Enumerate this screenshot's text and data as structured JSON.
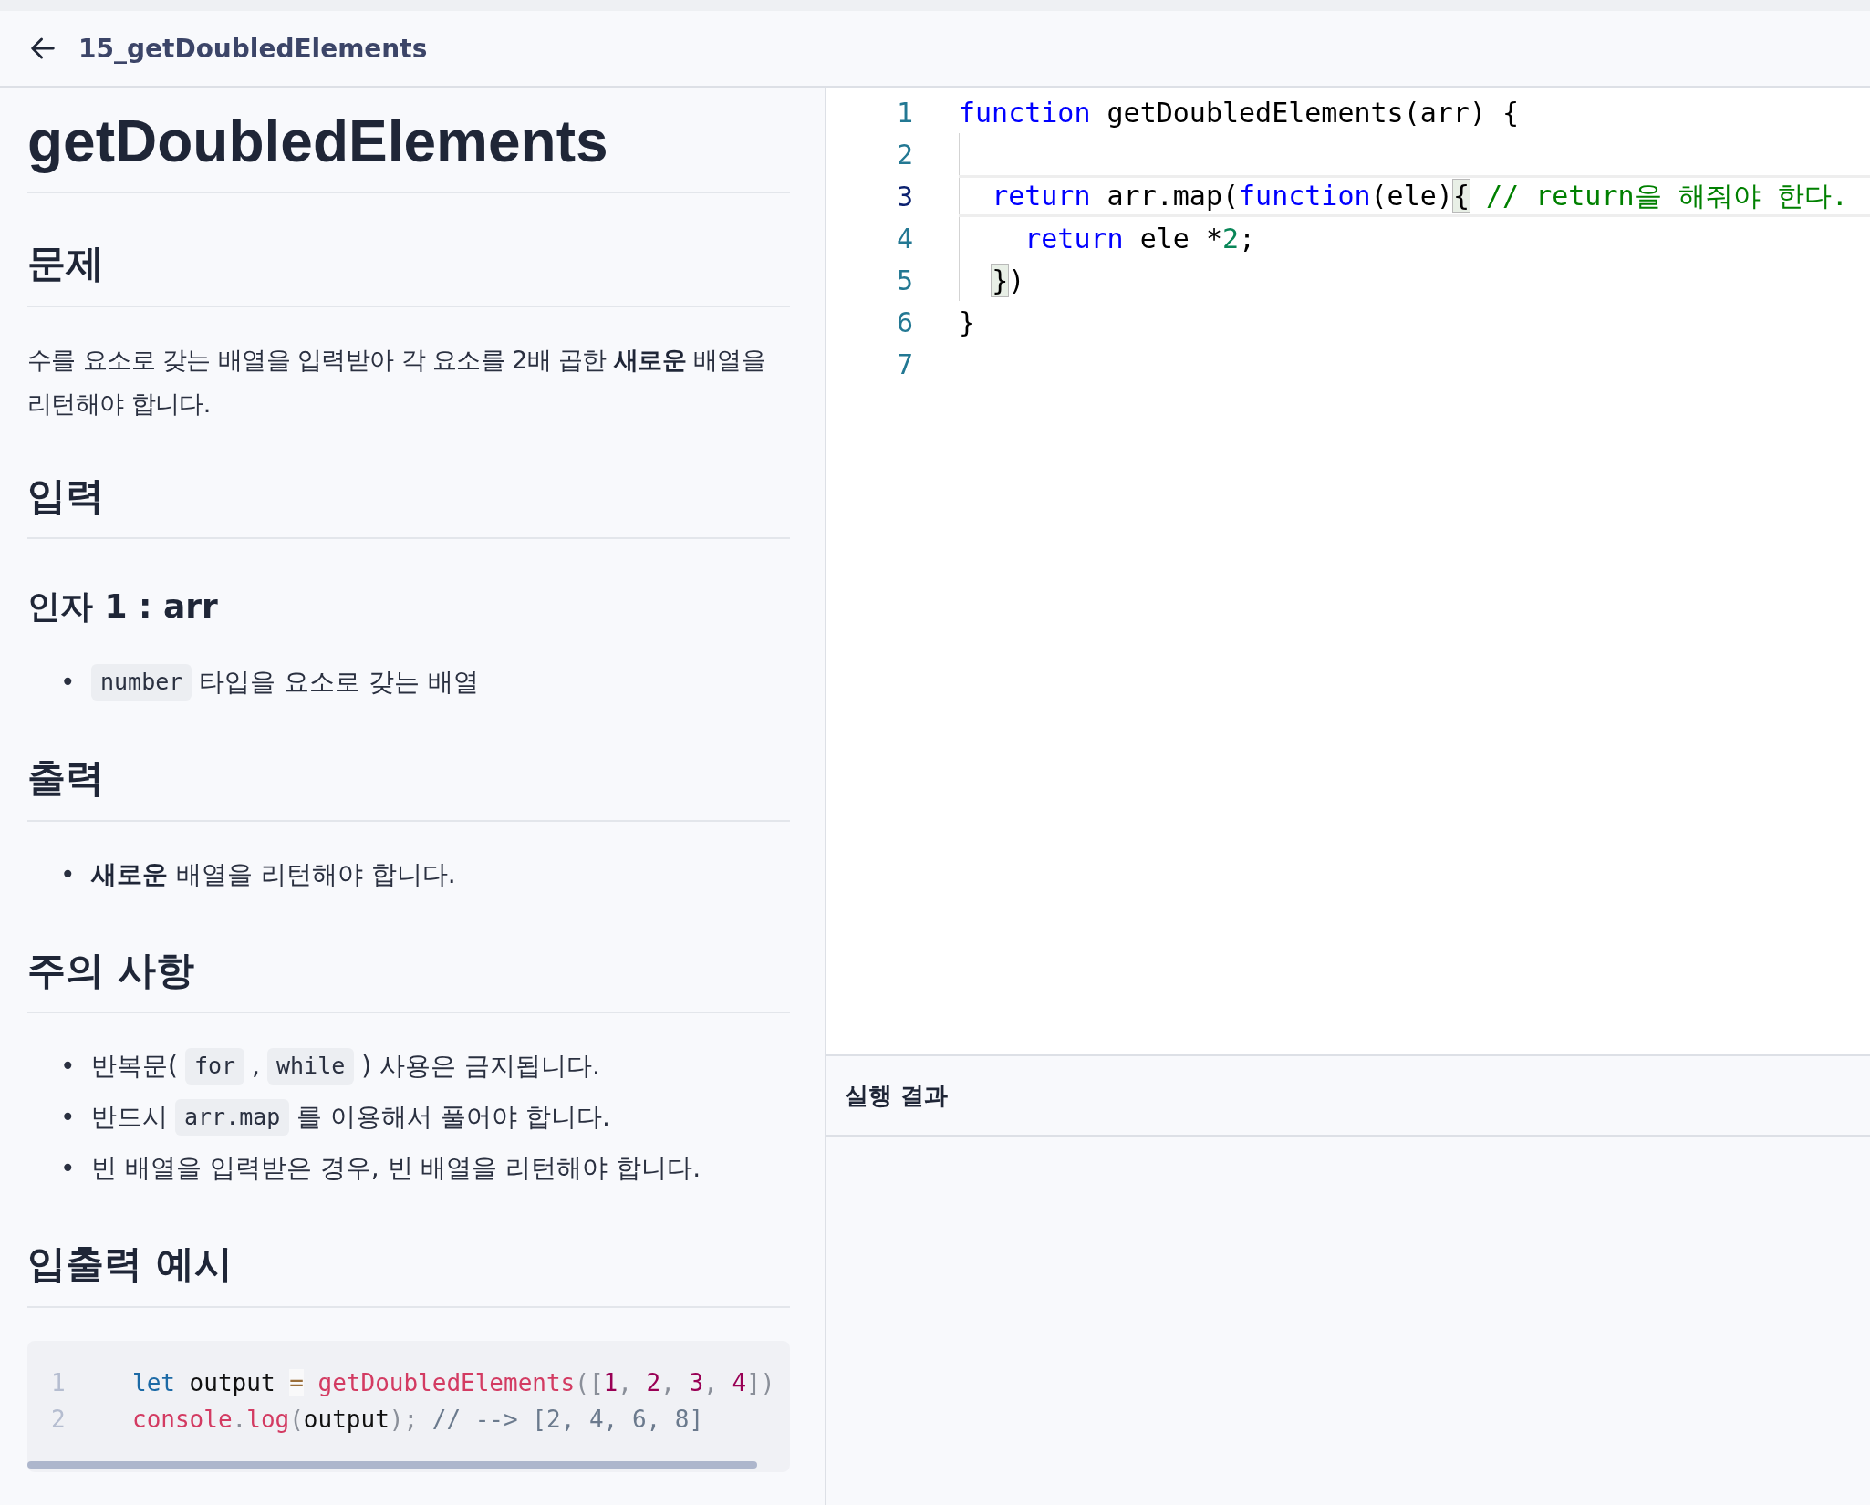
{
  "header": {
    "title": "15_getDoubledElements"
  },
  "problem": {
    "title": "getDoubledElements",
    "sections": [
      {
        "heading": "문제",
        "blocks": [
          {
            "kind": "paragraph",
            "text": "수를 요소로 갖는 배열을 입력받아 각 요소를 2배 곱한 **새로운** 배열을 리턴해야 합니다."
          }
        ]
      },
      {
        "heading": "입력",
        "blocks": [
          {
            "kind": "subheading",
            "text": "인자 1 : arr"
          },
          {
            "kind": "list",
            "bullet": "•",
            "items": [
              [
                {
                  "kind": "code",
                  "text": "number"
                },
                {
                  "kind": "text",
                  "text": "타입을 요소로 갖는 배열"
                }
              ]
            ]
          }
        ]
      },
      {
        "heading": "출력",
        "blocks": [
          {
            "kind": "list",
            "bullet": "•",
            "items": [
              [
                {
                  "kind": "text",
                  "text": "**새로운** 배열을 리턴해야 합니다."
                }
              ]
            ]
          }
        ]
      },
      {
        "heading": "주의 사항",
        "blocks": [
          {
            "kind": "list",
            "bullet": "•",
            "items": [
              [
                {
                  "kind": "text",
                  "text": "반복문("
                },
                {
                  "kind": "code",
                  "text": "for"
                },
                {
                  "kind": "text",
                  "text": ","
                },
                {
                  "kind": "code",
                  "text": "while"
                },
                {
                  "kind": "text",
                  "text": ") 사용은 금지됩니다."
                }
              ],
              [
                {
                  "kind": "text",
                  "text": "반드시"
                },
                {
                  "kind": "code",
                  "text": "arr.map"
                },
                {
                  "kind": "text",
                  "text": "를 이용해서 풀어야 합니다."
                }
              ],
              [
                {
                  "kind": "text",
                  "text": "빈 배열을 입력받은 경우, 빈 배열을 리턴해야 합니다."
                }
              ]
            ]
          }
        ]
      },
      {
        "heading": "입출력 예시",
        "blocks": [
          {
            "kind": "code_block",
            "lines": [
              {
                "number": "1",
                "tokens": [
                  {
                    "kind": "kw",
                    "text": "let"
                  },
                  {
                    "kind": "plain",
                    "text": " output "
                  },
                  {
                    "kind": "op",
                    "text": "="
                  },
                  {
                    "kind": "fn",
                    "text": " getDoubledElements"
                  },
                  {
                    "kind": "punc",
                    "text": "(["
                  },
                  {
                    "kind": "num",
                    "text": "1"
                  },
                  {
                    "kind": "punc",
                    "text": ", "
                  },
                  {
                    "kind": "num",
                    "text": "2"
                  },
                  {
                    "kind": "punc",
                    "text": ", "
                  },
                  {
                    "kind": "num",
                    "text": "3"
                  },
                  {
                    "kind": "punc",
                    "text": ", "
                  },
                  {
                    "kind": "num",
                    "text": "4"
                  },
                  {
                    "kind": "punc",
                    "text": "])"
                  }
                ]
              },
              {
                "number": "2",
                "tokens": [
                  {
                    "kind": "fn",
                    "text": "console"
                  },
                  {
                    "kind": "punc",
                    "text": "."
                  },
                  {
                    "kind": "fn",
                    "text": "log"
                  },
                  {
                    "kind": "punc",
                    "text": "("
                  },
                  {
                    "kind": "plain",
                    "text": "output"
                  },
                  {
                    "kind": "punc",
                    "text": "); "
                  },
                  {
                    "kind": "comment",
                    "text": "// --> [2, 4, 6, 8]"
                  }
                ]
              }
            ]
          }
        ]
      }
    ]
  },
  "editor": {
    "lines": [
      {
        "number": "1",
        "current": false,
        "tokens": [
          {
            "kind": "kw",
            "text": "function"
          },
          {
            "kind": "plain",
            "text": " getDoubledElements(arr) {"
          }
        ]
      },
      {
        "number": "2",
        "current": false
      },
      {
        "number": "3",
        "current": true,
        "tokens": [
          {
            "kind": "kw",
            "text": "  return"
          },
          {
            "kind": "plain",
            "text": " arr.map("
          },
          {
            "kind": "kw",
            "text": "function"
          },
          {
            "kind": "plain",
            "text": "(ele)"
          },
          {
            "kind": "match",
            "text": "{"
          },
          {
            "kind": "comment",
            "text": " // return을 해줘야 한다."
          }
        ]
      },
      {
        "number": "4",
        "current": false,
        "tokens": [
          {
            "kind": "kw",
            "text": "    return"
          },
          {
            "kind": "plain",
            "text": " ele *"
          },
          {
            "kind": "num",
            "text": "2"
          },
          {
            "kind": "plain",
            "text": ";"
          }
        ]
      },
      {
        "number": "5",
        "current": false,
        "tokens": [
          {
            "kind": "match",
            "text": "  }"
          },
          {
            "kind": "plain",
            "text": ")"
          }
        ]
      },
      {
        "number": "6",
        "current": false,
        "tokens": [
          {
            "kind": "plain",
            "text": "}"
          }
        ]
      },
      {
        "number": "7",
        "current": false
      }
    ]
  },
  "result": {
    "title": "실행 결과"
  }
}
